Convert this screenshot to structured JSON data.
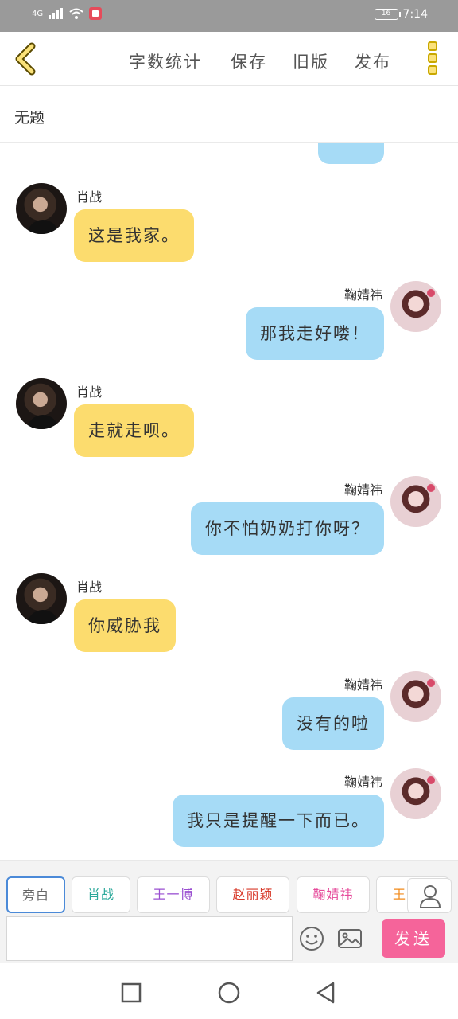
{
  "status_bar": {
    "network": "4G",
    "battery": "16",
    "time": "7:14"
  },
  "toolbar": {
    "back_icon": "chevron-left-icon",
    "menu": [
      "字数统计",
      "保存",
      "旧版",
      "发布"
    ],
    "more_icon": "more-vertical-icon"
  },
  "title": "无题",
  "colors": {
    "accent": "#f5649a",
    "left_bubble": "#fcdc6e",
    "right_bubble": "#a6dbf6",
    "active_chip_border": "#4b8ad8"
  },
  "messages": [
    {
      "side": "left",
      "name": "肖战",
      "text": "这是我家。"
    },
    {
      "side": "right",
      "name": "鞠婧祎",
      "text": "那我走好喽！"
    },
    {
      "side": "left",
      "name": "肖战",
      "text": "走就走呗。"
    },
    {
      "side": "right",
      "name": "鞠婧祎",
      "text": "你不怕奶奶打你呀？"
    },
    {
      "side": "left",
      "name": "肖战",
      "text": "你威胁我"
    },
    {
      "side": "right",
      "name": "鞠婧祎",
      "text": "没有的啦"
    },
    {
      "side": "right",
      "name": "鞠婧祎",
      "text": "我只是提醒一下而已。"
    }
  ],
  "characters": [
    {
      "label": "旁白",
      "color": "#666666"
    },
    {
      "label": "肖战",
      "color": "#2aa89a"
    },
    {
      "label": "王一博",
      "color": "#9a4fd1"
    },
    {
      "label": "赵丽颖",
      "color": "#d83a2a"
    },
    {
      "label": "鞠婧祎",
      "color": "#e64a9a"
    },
    {
      "label": "王",
      "color": "#f28a1a"
    }
  ],
  "composer": {
    "text": "",
    "send_label": "发送"
  }
}
